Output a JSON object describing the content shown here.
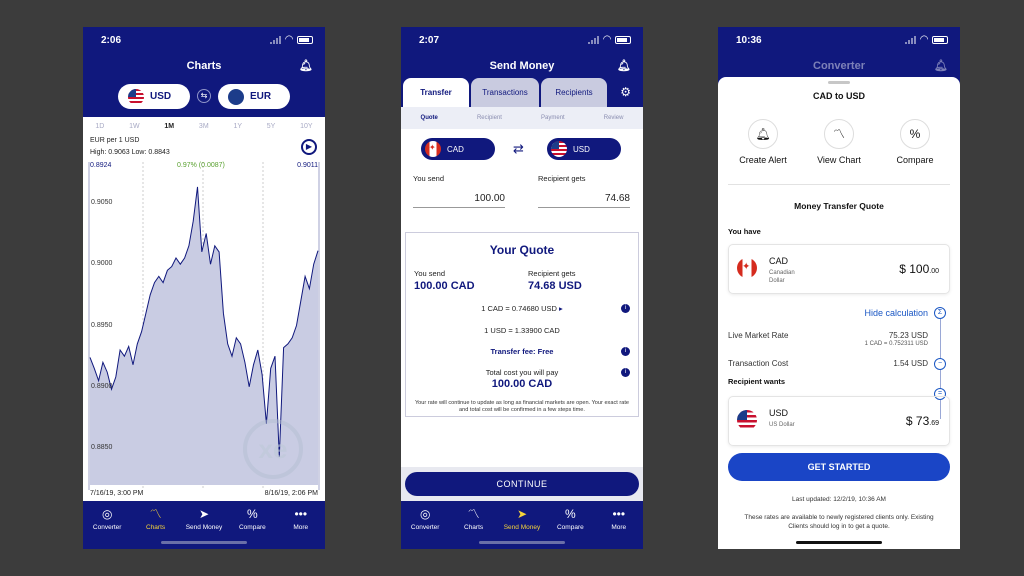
{
  "phone1": {
    "time": "2:06",
    "title": "Charts",
    "from_currency": "USD",
    "to_currency": "EUR",
    "ranges": [
      "1D",
      "1W",
      "1M",
      "3M",
      "1Y",
      "5Y",
      "10Y"
    ],
    "active_range": "1M",
    "pair_label": "EUR per 1 USD",
    "high_low": "High: 0.9063  Low: 0.8843",
    "open_value": "0.8924",
    "change": "0.97% (0.0087)",
    "close_value": "0.9011",
    "y_ticks": [
      "0.9050",
      "0.9000",
      "0.8950",
      "0.8900",
      "0.8850"
    ],
    "start_date": "7/16/19, 3:00 PM",
    "end_date": "8/16/19, 2:06 PM",
    "watermark": "xe"
  },
  "phone2": {
    "time": "2:07",
    "title": "Send Money",
    "tabs": [
      "Transfer",
      "Transactions",
      "Recipients"
    ],
    "steps": [
      "Quote",
      "Recipient",
      "Payment",
      "Review"
    ],
    "from_currency": "CAD",
    "to_currency": "USD",
    "you_send_label": "You send",
    "recipient_gets_label": "Recipient gets",
    "send_amount": "100.00",
    "receive_amount": "74.68",
    "quote_title": "Your Quote",
    "quote_send_amount": "100.00 CAD",
    "quote_receive_amount": "74.68 USD",
    "rate1": "1 CAD = 0.74680 USD",
    "rate2": "1 USD = 1.33900 CAD",
    "fee": "Transfer fee: Free",
    "total_label": "Total cost you will pay",
    "total_value": "100.00 CAD",
    "disclaimer": "Your rate will continue to update as long as financial markets are open. Your exact rate and total cost will be confirmed in a few steps time.",
    "continue_label": "CONTINUE"
  },
  "phone3": {
    "time": "10:36",
    "title": "Converter",
    "sheet_title": "CAD to USD",
    "actions": [
      "Create Alert",
      "View Chart",
      "Compare"
    ],
    "quote_title": "Money Transfer Quote",
    "you_have_label": "You have",
    "have_code": "CAD",
    "have_name": "Canadian Dollar",
    "have_amount": "$ 100",
    "have_cents": ".00",
    "hide_calc": "Hide calculation",
    "live_rate_label": "Live Market Rate",
    "live_rate_value": "75.23 USD",
    "live_rate_detail": "1 CAD = 0.752311 USD",
    "transaction_cost_label": "Transaction Cost",
    "transaction_cost_value": "1.54 USD",
    "recipient_wants_label": "Recipient wants",
    "want_code": "USD",
    "want_name": "US Dollar",
    "want_amount": "$ 73",
    "want_cents": ".69",
    "cta": "GET STARTED",
    "last_updated": "Last updated: 12/2/19, 10:36 AM",
    "note": "These rates are available to newly registered clients only. Existing Clients should log in to get a quote."
  },
  "tabbar": {
    "items": [
      "Converter",
      "Charts",
      "Send Money",
      "Compare",
      "More"
    ]
  },
  "chart_data": {
    "type": "line",
    "title": "EUR per 1 USD",
    "x": [
      "7/16/19, 3:00 PM",
      "8/16/19, 2:06 PM"
    ],
    "ylim": [
      0.882,
      0.908
    ],
    "values": [
      0.8924,
      0.8915,
      0.8905,
      0.892,
      0.8912,
      0.8898,
      0.8908,
      0.893,
      0.8925,
      0.8933,
      0.8918,
      0.8935,
      0.8945,
      0.896,
      0.8975,
      0.8985,
      0.899,
      0.8985,
      0.8995,
      0.8998,
      0.9005,
      0.9,
      0.9005,
      0.9015,
      0.9035,
      0.9063,
      0.901,
      0.9025,
      0.9,
      0.9015,
      0.901,
      0.896,
      0.8935,
      0.8925,
      0.894,
      0.8935,
      0.892,
      0.89,
      0.8918,
      0.893,
      0.891,
      0.887,
      0.8915,
      0.8925,
      0.8843,
      0.8932,
      0.8935,
      0.894,
      0.895,
      0.897,
      0.899,
      0.898,
      0.9,
      0.9011
    ]
  }
}
